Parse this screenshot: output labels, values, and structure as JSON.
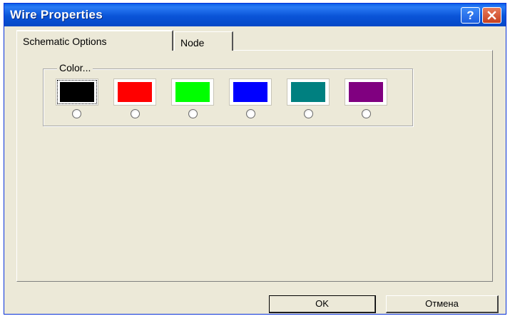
{
  "window": {
    "title": "Wire Properties",
    "help_glyph": "?",
    "close_icon": "close-icon"
  },
  "tabs": [
    {
      "label": "Schematic Options",
      "active": true
    },
    {
      "label": "Node",
      "active": false
    }
  ],
  "color_group": {
    "label": "Color...",
    "swatches": [
      {
        "color": "#000000",
        "selected": true
      },
      {
        "color": "#ff0000",
        "selected": false
      },
      {
        "color": "#00ff00",
        "selected": false
      },
      {
        "color": "#0000ff",
        "selected": false
      },
      {
        "color": "#008080",
        "selected": false
      },
      {
        "color": "#800080",
        "selected": false
      }
    ]
  },
  "buttons": {
    "ok_label": "OK",
    "cancel_label": "Отмена"
  }
}
